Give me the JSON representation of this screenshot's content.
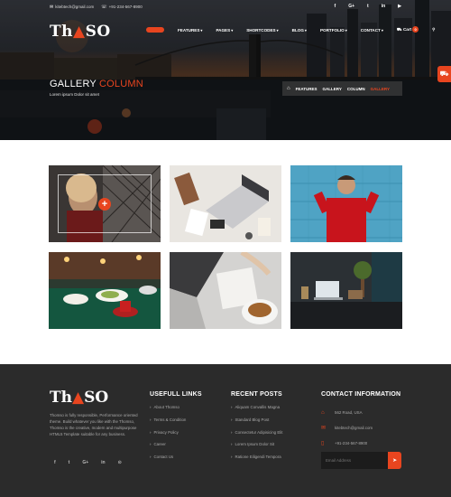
{
  "topbar": {
    "email": "kitebtech@gmail.com",
    "phone": "+91-234-567-8900"
  },
  "social_top": [
    "f",
    "G+",
    "t",
    "in",
    "▶"
  ],
  "logo": {
    "pre": "Th",
    "mark": "▲",
    "post": "SO"
  },
  "nav": {
    "items": [
      {
        "label": "FEATURES"
      },
      {
        "label": "PAGES"
      },
      {
        "label": "SHORTCODES"
      },
      {
        "label": "BLOG"
      },
      {
        "label": "PORTFOLIO"
      },
      {
        "label": "CONTACT"
      }
    ],
    "cart_label": "Cart",
    "cart_count": "0"
  },
  "page": {
    "title_main": "GALLERY",
    "title_accent": "COLUMN",
    "subtitle": "Lorem ipsum Dolor sit amet"
  },
  "breadcrumb": [
    "FEATURES",
    "GALLERY",
    "COLUMN",
    "GALLERY"
  ],
  "gallery": {
    "plus": "+"
  },
  "footer": {
    "about": "Thomso is fully responsible, Performance oriented theme. Build whatever you like with the Thomso, Thomso is the creative, modern and multipurpose HTML5 Template suitable for any business.",
    "social": [
      "f",
      "t",
      "G+",
      "in",
      "⊙"
    ],
    "links_title": "USEFULL LINKS",
    "links": [
      "About Thomso",
      "Terms & Condition",
      "Privacy Policy",
      "Career",
      "Contact Us"
    ],
    "posts_title": "RECENT POSTS",
    "posts": [
      "Aliquam Convallis Magna",
      "Standard Blog Post",
      "Consectetur Adipisicing Elit",
      "Lorem Ipsum Dolor Sit",
      "Ratione Eiligendi Tempora"
    ],
    "contact_title": "CONTACT INFORMATION",
    "contact": [
      "562 Road, USA",
      "kitebtech@gmail.com",
      "+91-234-567-8900"
    ],
    "subscribe_placeholder": "Email Address"
  },
  "colors": {
    "accent": "#e8451f",
    "footer_bg": "#2b2b2b"
  }
}
